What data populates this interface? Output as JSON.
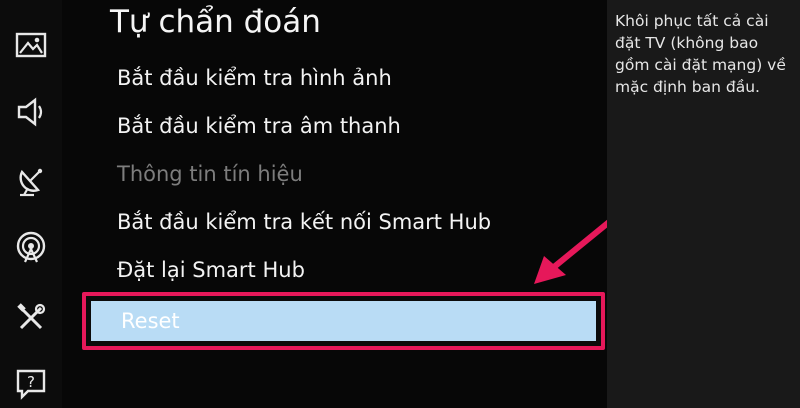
{
  "sidebar": {
    "icons": [
      {
        "name": "picture-icon"
      },
      {
        "name": "sound-icon"
      },
      {
        "name": "broadcasting-icon"
      },
      {
        "name": "network-icon"
      },
      {
        "name": "tools-icon"
      },
      {
        "name": "help-icon"
      }
    ]
  },
  "menu": {
    "title": "Tự chẩn đoán",
    "items": [
      {
        "label": "Bắt đầu kiểm tra hình ảnh",
        "enabled": true
      },
      {
        "label": "Bắt đầu kiểm tra âm thanh",
        "enabled": true
      },
      {
        "label": "Thông tin tín hiệu",
        "enabled": false
      },
      {
        "label": "Bắt đầu kiểm tra kết nối Smart Hub",
        "enabled": true
      },
      {
        "label": "Đặt lại Smart Hub",
        "enabled": true
      }
    ],
    "selected_label": "Reset"
  },
  "description": {
    "text": "Khôi phục tất cả cài đặt TV (không bao gồm cài đặt mạng) về mặc định ban đầu."
  },
  "colors": {
    "highlight_border": "#e6185a",
    "selection_fill": "#b9dcf5",
    "annotation_arrow": "#e6185a"
  }
}
